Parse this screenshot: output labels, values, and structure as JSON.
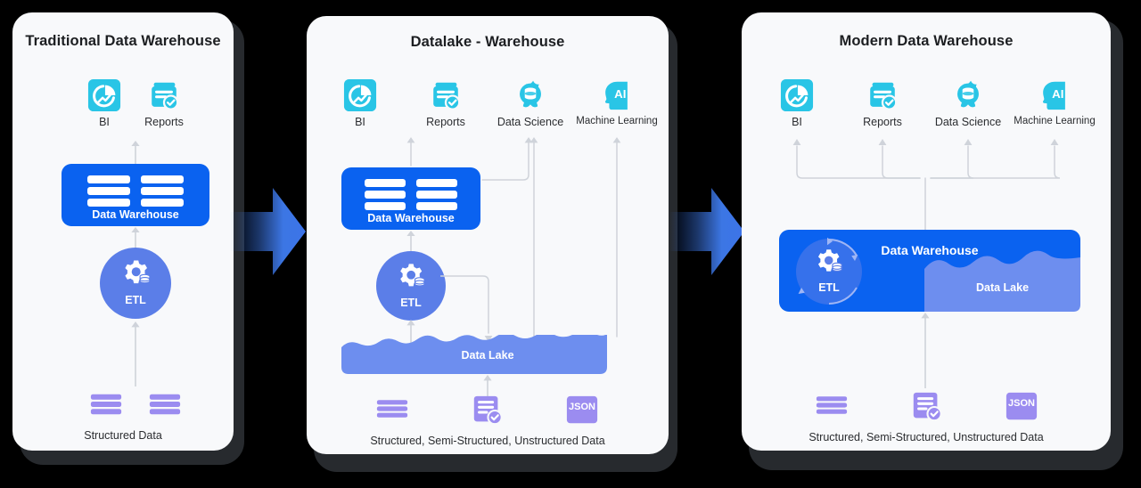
{
  "background_color": "#000000",
  "colors": {
    "card": "#f8f9fb",
    "card_shadow": "#272a2e",
    "accent_blue": "#0a62f0",
    "periwinkle": "#5b7ee8",
    "lake_blue": "#6d8eef",
    "cyan": "#29c5e6",
    "purple": "#9b8cf0",
    "connector": "#cfd3da",
    "title_text": "#1c1e21",
    "label_text": "#2b2d30"
  },
  "panels": [
    {
      "id": "traditional",
      "title": "Traditional Data Warehouse",
      "consumers": [
        {
          "label": "BI",
          "icon": "bi-chart-icon"
        },
        {
          "label": "Reports",
          "icon": "reports-document-icon"
        }
      ],
      "warehouse": {
        "label": "Data Warehouse",
        "icon": "database-bars-icon"
      },
      "etl": {
        "label": "ETL",
        "icon": "gear-database-icon"
      },
      "sources": {
        "caption": "Structured Data",
        "items": [
          {
            "icon": "structured-bars-icon"
          },
          {
            "icon": "structured-bars-icon"
          }
        ]
      }
    },
    {
      "id": "datalake-warehouse",
      "title": "Datalake - Warehouse",
      "consumers": [
        {
          "label": "BI",
          "icon": "bi-chart-icon"
        },
        {
          "label": "Reports",
          "icon": "reports-document-icon"
        },
        {
          "label": "Data Science",
          "icon": "data-science-flower-icon"
        },
        {
          "label": "Machine Learning",
          "icon": "ai-head-icon"
        }
      ],
      "warehouse": {
        "label": "Data Warehouse",
        "icon": "database-bars-icon"
      },
      "etl": {
        "label": "ETL",
        "icon": "gear-database-icon"
      },
      "lake": {
        "label": "Data Lake"
      },
      "sources": {
        "caption": "Structured, Semi-Structured, Unstructured Data",
        "items": [
          {
            "icon": "structured-bars-icon"
          },
          {
            "icon": "semi-structured-doc-icon"
          },
          {
            "icon": "json-box-icon",
            "label": "JSON"
          }
        ]
      }
    },
    {
      "id": "modern",
      "title": "Modern Data Warehouse",
      "consumers": [
        {
          "label": "BI",
          "icon": "bi-chart-icon"
        },
        {
          "label": "Reports",
          "icon": "reports-document-icon"
        },
        {
          "label": "Data Science",
          "icon": "data-science-flower-icon"
        },
        {
          "label": "Machine Learning",
          "icon": "ai-head-icon"
        }
      ],
      "warehouse": {
        "label": "Data Warehouse"
      },
      "etl": {
        "label": "ETL",
        "icon": "gear-database-icon"
      },
      "lake": {
        "label": "Data Lake"
      },
      "sources": {
        "caption": "Structured, Semi-Structured, Unstructured Data",
        "items": [
          {
            "icon": "structured-bars-icon"
          },
          {
            "icon": "semi-structured-doc-icon"
          },
          {
            "icon": "json-box-icon",
            "label": "JSON"
          }
        ]
      }
    }
  ],
  "transitions": [
    {
      "icon": "right-chevron-arrow-icon"
    },
    {
      "icon": "right-chevron-arrow-icon"
    }
  ]
}
